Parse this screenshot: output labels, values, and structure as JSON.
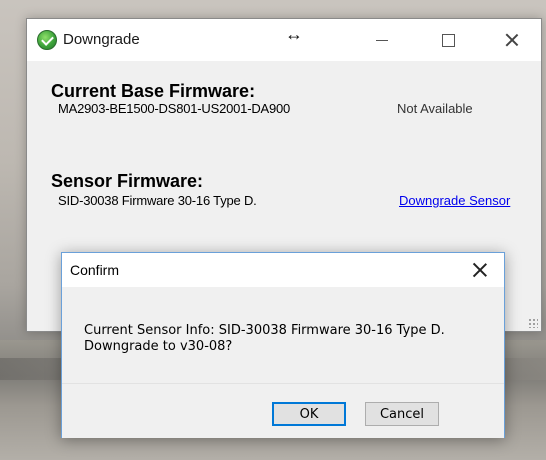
{
  "main_window": {
    "title": "Downgrade",
    "resize_glyph": "↔",
    "current_base": {
      "heading": "Current Base Firmware:",
      "value": "MA2903-BE1500-DS801-US2001-DA900",
      "status": "Not Available"
    },
    "sensor": {
      "heading": "Sensor Firmware:",
      "value": "SID-30038 Firmware 30-16 Type D.",
      "link": "Downgrade Sensor"
    },
    "icons": [
      "app-globe-icon",
      "minimize-icon",
      "maximize-icon",
      "close-icon",
      "resize-grip-icon"
    ]
  },
  "confirm_dialog": {
    "title": "Confirm",
    "message_line1": "Current Sensor Info: SID-30038 Firmware 30-16 Type D.",
    "message_line2": "Downgrade to v30-08?",
    "ok_label": "OK",
    "cancel_label": "Cancel"
  },
  "colors": {
    "link": "#0000ee",
    "focus_border": "#0078d7",
    "window_bg": "#f0f0f0"
  }
}
